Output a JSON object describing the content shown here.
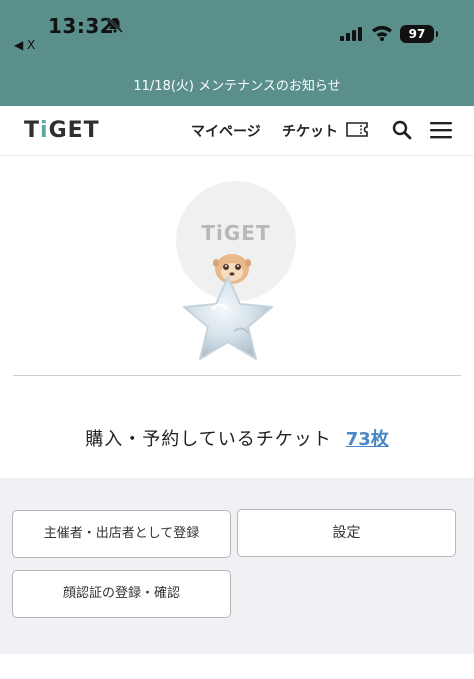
{
  "status_bar": {
    "time": "13:32",
    "back_label": "◀ X",
    "battery": "97",
    "background": "#5a8f8c"
  },
  "notice": {
    "text": "11/18(火) メンテナンスのお知らせ"
  },
  "header": {
    "logo_prefix": "T",
    "logo_i": "i",
    "logo_suffix": "GET",
    "nav_mypage": "マイページ",
    "nav_ticket": "チケット",
    "icons": [
      "ticket-icon",
      "search-icon",
      "menu-icon"
    ]
  },
  "profile": {
    "avatar_logo": "TiGET"
  },
  "tickets": {
    "label": "購入・予約しているチケット",
    "count": "73枚",
    "link_color": "#4a88c5"
  },
  "actions": {
    "organizer_register": "主催者・出店者として登録",
    "settings": "設定",
    "face_auth": "顔認証の登録・確認"
  }
}
